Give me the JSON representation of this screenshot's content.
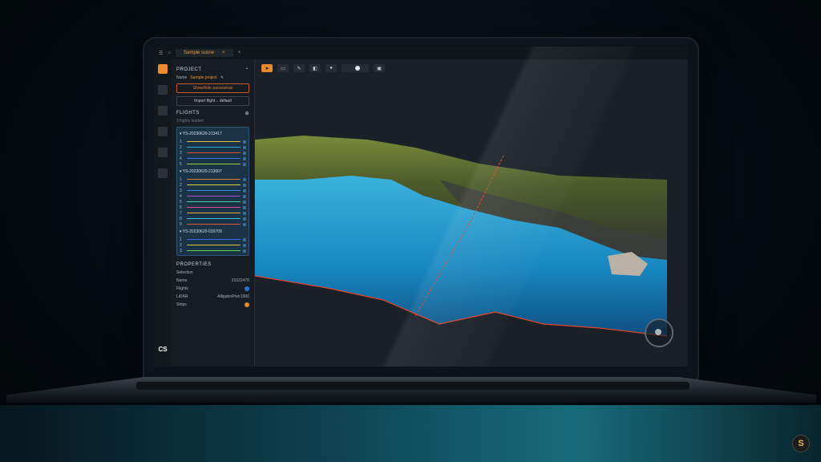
{
  "app": {
    "tab_label": "Sample scene",
    "tab_close": "×"
  },
  "project": {
    "section": "PROJECT",
    "name_label": "Name",
    "name_value": "Sample project",
    "button_primary": "Show/hide panoramas",
    "button_secondary": "Import flight... default"
  },
  "flights": {
    "section": "FLIGHTS",
    "subtitle": "3 flights loaded",
    "groups": [
      {
        "name": "YS-20230620-213417",
        "lines": [
          {
            "n": "1",
            "color": "#e0c23a"
          },
          {
            "n": "2",
            "color": "#2aa8d8"
          },
          {
            "n": "3",
            "color": "#e04e3a"
          },
          {
            "n": "4",
            "color": "#3a7ae0"
          },
          {
            "n": "5",
            "color": "#9ad04a"
          }
        ]
      },
      {
        "name": "YS-20230620-213007",
        "lines": [
          {
            "n": "1",
            "color": "#e07a3a"
          },
          {
            "n": "2",
            "color": "#d8d03a"
          },
          {
            "n": "3",
            "color": "#3a8ae0"
          },
          {
            "n": "4",
            "color": "#b04ad0"
          },
          {
            "n": "5",
            "color": "#4ad0a0"
          },
          {
            "n": "6",
            "color": "#e04e8a"
          },
          {
            "n": "7",
            "color": "#e0b03a"
          },
          {
            "n": "8",
            "color": "#3ac0e0"
          },
          {
            "n": "9",
            "color": "#e05a3a"
          }
        ]
      },
      {
        "name": "YS-20230620-020709",
        "lines": [
          {
            "n": "1",
            "color": "#3a6ae0"
          },
          {
            "n": "2",
            "color": "#e0c03a"
          },
          {
            "n": "3",
            "color": "#6ad04a"
          }
        ]
      }
    ]
  },
  "properties": {
    "section": "PROPERTIES",
    "selection": "Selection",
    "name_label": "Name",
    "name_value": "21022470",
    "flights_label": "Flights",
    "lidar_label": "LiDAR",
    "lidar_value": "AlligatorPrior1000",
    "strips_label": "Strips",
    "flights_color": "#2f6fd6",
    "strips_color": "#e88b2e"
  },
  "logo_text": "CS",
  "corner_badge": "S"
}
